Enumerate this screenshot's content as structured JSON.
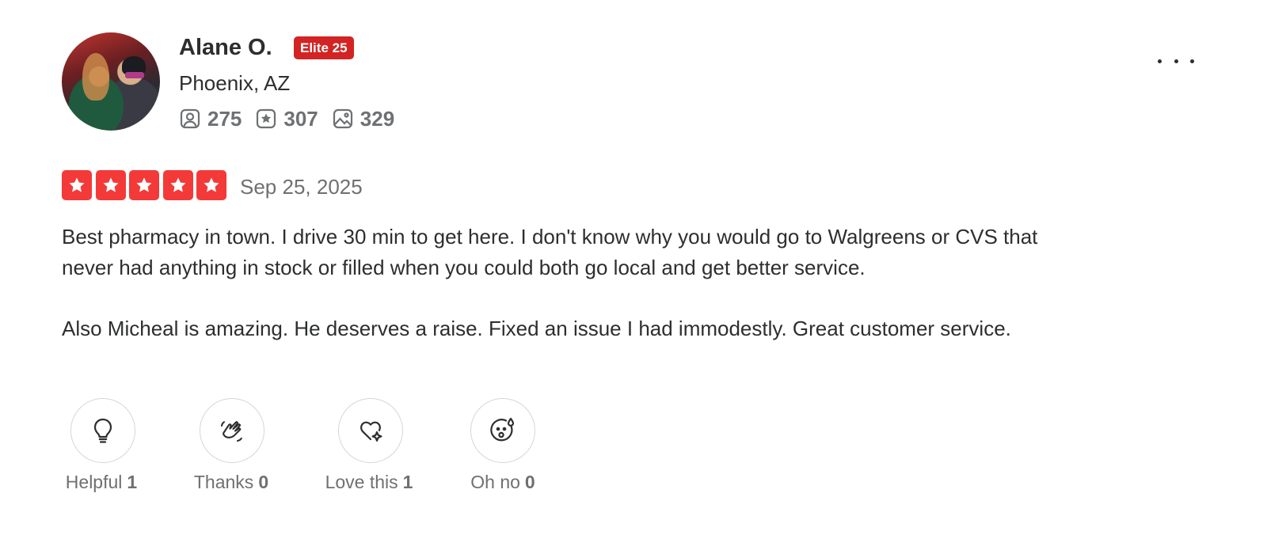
{
  "reviewer": {
    "name": "Alane O.",
    "badge": "Elite 25",
    "location": "Phoenix, AZ",
    "stats": {
      "friends": "275",
      "reviews": "307",
      "photos": "329"
    }
  },
  "review": {
    "rating": 5,
    "date": "Sep 25, 2025",
    "paragraphs": [
      "Best pharmacy in town. I drive 30 min to get here. I don't know why you would go to Walgreens or CVS that never had anything in stock or filled when you could both go local and get better service.",
      "Also Micheal is amazing. He deserves a raise. Fixed an issue I had immodestly. Great customer service."
    ]
  },
  "reactions": [
    {
      "label": "Helpful",
      "count": "1",
      "icon": "lightbulb-icon"
    },
    {
      "label": "Thanks",
      "count": "0",
      "icon": "waving-hands-icon"
    },
    {
      "label": "Love this",
      "count": "1",
      "icon": "heart-sparkle-icon"
    },
    {
      "label": "Oh no",
      "count": "0",
      "icon": "surprised-face-icon"
    }
  ],
  "colors": {
    "star_red": "#f43939",
    "elite_red": "#d32323",
    "text": "#2d2e2f",
    "muted": "#6e7072"
  }
}
